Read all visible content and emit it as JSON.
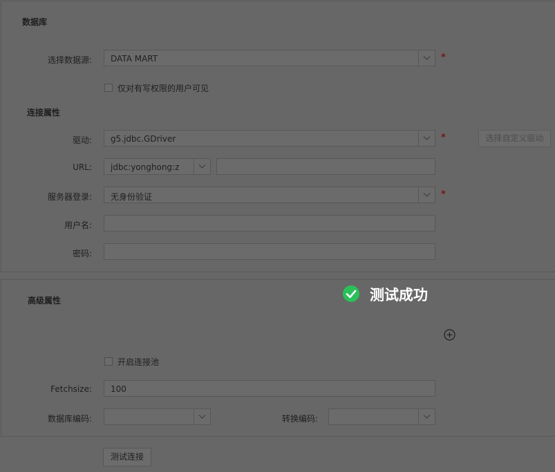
{
  "database_section": {
    "title": "数据库",
    "datasource": {
      "label": "选择数据源:",
      "value": "DATA MART",
      "required": "*"
    },
    "write_only": {
      "label": "仅对有写权限的用户可见",
      "checked": false
    }
  },
  "connection_section": {
    "title": "连接属性",
    "driver": {
      "label": "驱动:",
      "value": "g5.jdbc.GDriver",
      "required": "*",
      "custom_button": "选择自定义驱动"
    },
    "url": {
      "label": "URL:",
      "prefix": "jdbc:yonghong:z",
      "value": ""
    },
    "server_login": {
      "label": "服务器登录:",
      "value": "无身份验证",
      "required": "*"
    },
    "username": {
      "label": "用户名:",
      "value": ""
    },
    "password": {
      "label": "密码:",
      "value": ""
    }
  },
  "advanced_section": {
    "title": "高级属性",
    "pool": {
      "label": "开启连接池",
      "checked": false
    },
    "fetchsize": {
      "label": "Fetchsize:",
      "value": "100"
    },
    "db_encoding": {
      "label": "数据库编码:",
      "value": ""
    },
    "convert_encoding": {
      "label": "转换编码:",
      "value": ""
    }
  },
  "test_button": "测试连接",
  "toast": {
    "message": "测试成功",
    "icon": "check-circle-icon",
    "color": "#2bbf5a"
  },
  "icons": {
    "dropdown": "chevron-down-icon",
    "add": "plus-circle-icon"
  }
}
